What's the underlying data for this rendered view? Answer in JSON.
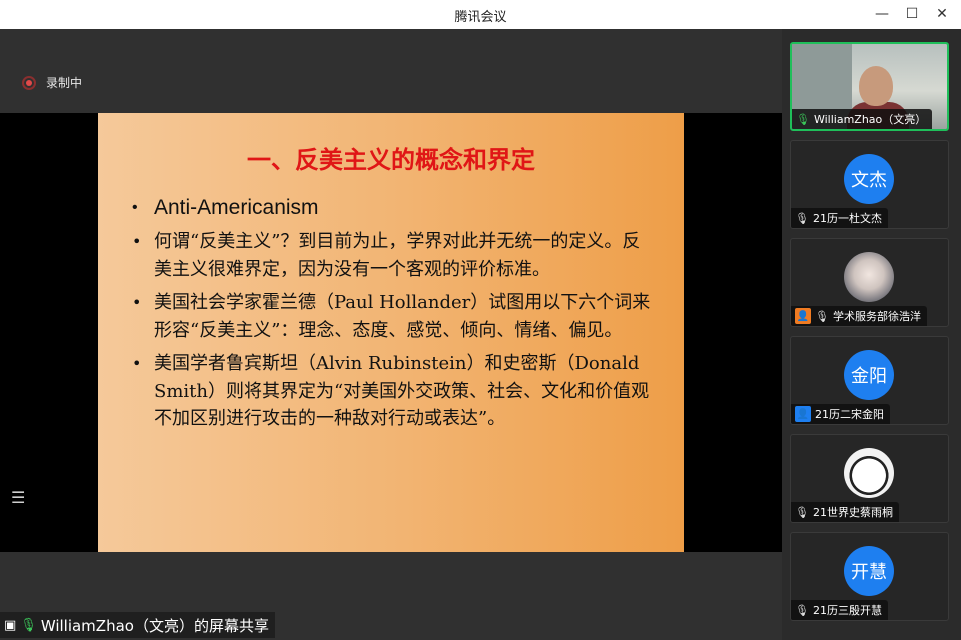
{
  "window": {
    "title": "腾讯会议"
  },
  "recording": {
    "label": "录制中"
  },
  "slide": {
    "title": "一、反美主义的概念和界定",
    "bullets": [
      "Anti-Americanism",
      "何谓“反美主义”？到目前为止，学界对此并无统一的定义。反美主义很难界定，因为没有一个客观的评价标准。",
      "美国社会学家霍兰德（Paul Hollander）试图用以下六个词来形容“反美主义”：理念、态度、感觉、倾向、情绪、偏见。",
      "美国学者鲁宾斯坦（Alvin Rubinstein）和史密斯（Donald Smith）则将其界定为“对美国外交政策、社会、文化和价值观不加区别进行攻击的一种敌对行动或表达”。"
    ]
  },
  "screen_share": {
    "label": "WilliamZhao（文亮）的屏幕共享"
  },
  "participants": [
    {
      "name": "WilliamZhao（文亮）",
      "avatar_text": "",
      "type": "video"
    },
    {
      "name": "21历一杜文杰",
      "avatar_text": "文杰",
      "type": "avatar"
    },
    {
      "name": "学术服务部徐浩洋",
      "avatar_text": "",
      "type": "photo"
    },
    {
      "name": "21历二宋金阳",
      "avatar_text": "金阳",
      "type": "avatar"
    },
    {
      "name": "21世界史蔡雨桐",
      "avatar_text": "",
      "type": "photo"
    },
    {
      "name": "21历三殷开慧",
      "avatar_text": "开慧",
      "type": "avatar"
    }
  ],
  "colors": {
    "active_speaker": "#1fbf5a",
    "avatar_blue": "#1e7ff0",
    "slide_title_red": "#e01616",
    "recording_red": "#e04a4a"
  },
  "icons": [
    "minimize-icon",
    "maximize-icon",
    "close-icon",
    "record-icon",
    "list-icon",
    "screen-share-icon",
    "mic-icon",
    "user-badge-icon"
  ]
}
